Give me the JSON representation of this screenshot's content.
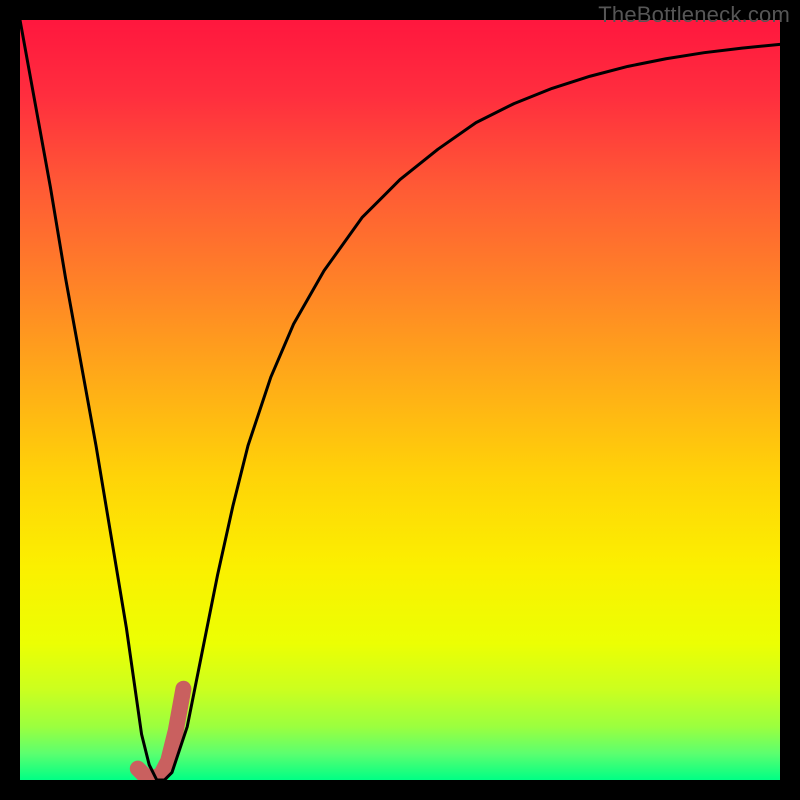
{
  "watermark": "TheBottleneck.com",
  "colors": {
    "frame": "#000000",
    "curve": "#000000",
    "accent": "#c9605f",
    "watermark": "#565656"
  },
  "chart_data": {
    "type": "line",
    "title": "",
    "xlabel": "",
    "ylabel": "",
    "xlim": [
      0,
      100
    ],
    "ylim": [
      0,
      100
    ],
    "x": [
      0,
      2,
      4,
      6,
      8,
      10,
      12,
      14,
      15,
      16,
      17,
      18,
      19,
      20,
      22,
      24,
      26,
      28,
      30,
      33,
      36,
      40,
      45,
      50,
      55,
      60,
      65,
      70,
      75,
      80,
      85,
      90,
      95,
      100
    ],
    "series": [
      {
        "name": "bottleneck-curve",
        "color": "#000000",
        "stroke_width": 3,
        "values": [
          100,
          89,
          78,
          66,
          55,
          44,
          32,
          20,
          13,
          6,
          2,
          0,
          0,
          1,
          7,
          17,
          27,
          36,
          44,
          53,
          60,
          67,
          74,
          79,
          83,
          86.5,
          89,
          91,
          92.6,
          93.9,
          94.9,
          95.7,
          96.3,
          96.8
        ]
      },
      {
        "name": "accent-segment",
        "color": "#c9605f",
        "stroke_width": 16,
        "x": [
          15.5,
          16.5,
          17.5,
          18.5,
          19.5,
          20.5,
          21.5
        ],
        "values": [
          1.5,
          0.5,
          0.3,
          0.6,
          2.5,
          6.5,
          12
        ]
      }
    ],
    "gradient_stops": [
      {
        "offset": 0.0,
        "color": "#ff173e"
      },
      {
        "offset": 0.1,
        "color": "#ff2e3e"
      },
      {
        "offset": 0.22,
        "color": "#ff5a35"
      },
      {
        "offset": 0.35,
        "color": "#ff8327"
      },
      {
        "offset": 0.48,
        "color": "#ffad17"
      },
      {
        "offset": 0.6,
        "color": "#ffd308"
      },
      {
        "offset": 0.72,
        "color": "#fbf000"
      },
      {
        "offset": 0.82,
        "color": "#ecff03"
      },
      {
        "offset": 0.88,
        "color": "#ccff1e"
      },
      {
        "offset": 0.93,
        "color": "#9bff3f"
      },
      {
        "offset": 0.965,
        "color": "#5cff6f"
      },
      {
        "offset": 1.0,
        "color": "#00ff85"
      }
    ],
    "grid": false,
    "legend": false
  }
}
